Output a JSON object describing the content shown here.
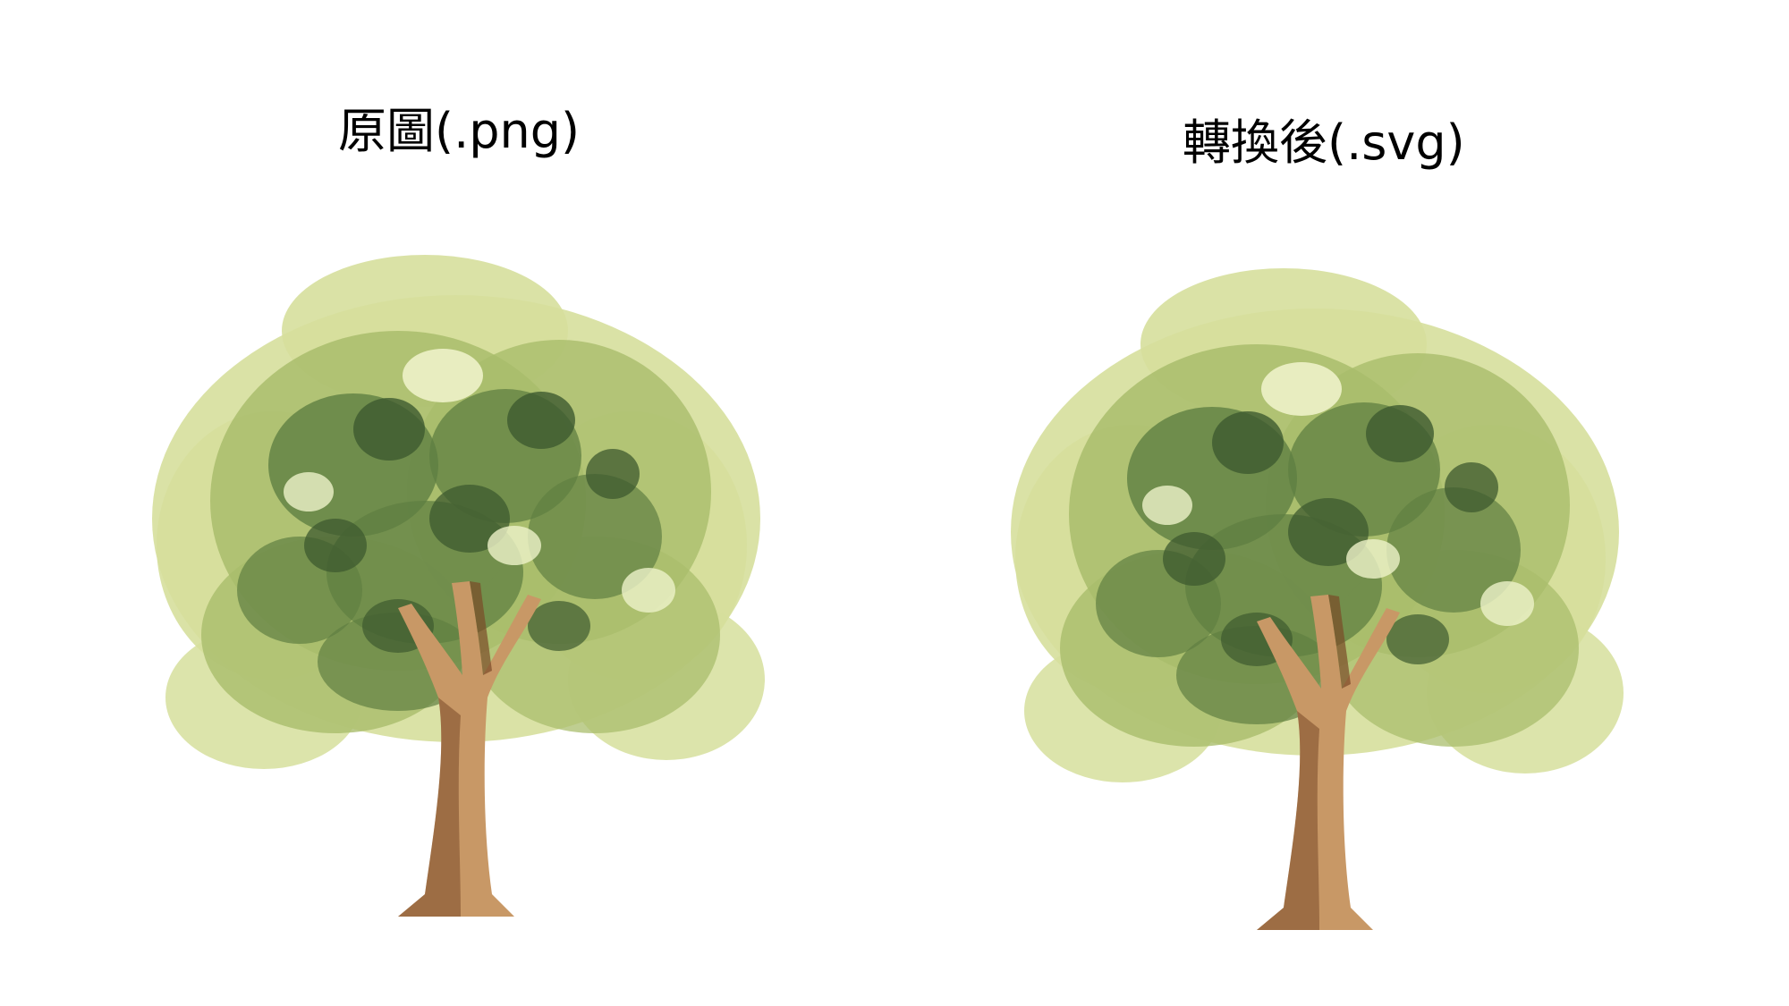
{
  "captions": {
    "left": "原圖(.png)",
    "right": "轉換後(.svg)"
  },
  "colors": {
    "foliage_light": "#d6df9c",
    "foliage_mid": "#a9bd6c",
    "foliage_dark": "#5f7f42",
    "foliage_deep": "#3d5a2f",
    "trunk_light": "#c89866",
    "trunk_dark": "#7a4a28"
  },
  "panels": [
    {
      "name": "original-png"
    },
    {
      "name": "converted-svg"
    }
  ]
}
